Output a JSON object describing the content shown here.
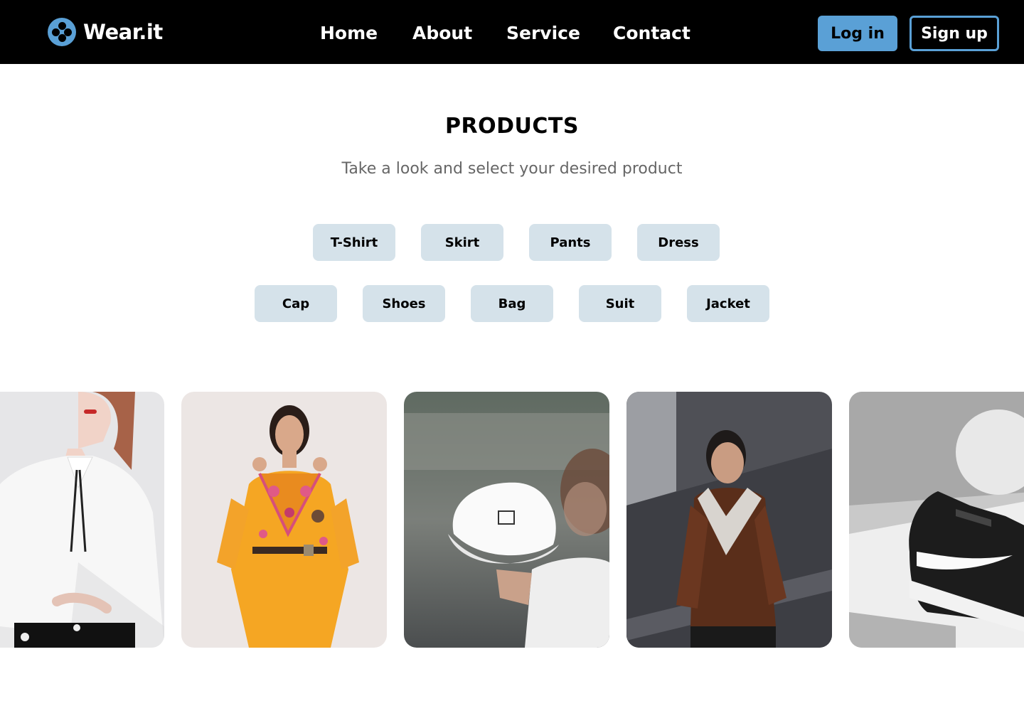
{
  "brand": {
    "name": "Wear.it",
    "accent": "#5aa0d6"
  },
  "nav": {
    "links": [
      "Home",
      "About",
      "Service",
      "Contact"
    ],
    "login_label": "Log in",
    "signup_label": "Sign up"
  },
  "main": {
    "title": "PRODUCTS",
    "subtitle": "Take a look and select your desired product",
    "categories_row1": [
      "T-Shirt",
      "Skirt",
      "Pants",
      "Dress"
    ],
    "categories_row2": [
      "Cap",
      "Shoes",
      "Bag",
      "Suit",
      "Jacket"
    ]
  },
  "products": [
    {
      "icon": "white-blouse-photo"
    },
    {
      "icon": "yellow-dress-photo"
    },
    {
      "icon": "white-cap-photo"
    },
    {
      "icon": "brown-jacket-photo"
    },
    {
      "icon": "black-sneaker-photo"
    }
  ]
}
